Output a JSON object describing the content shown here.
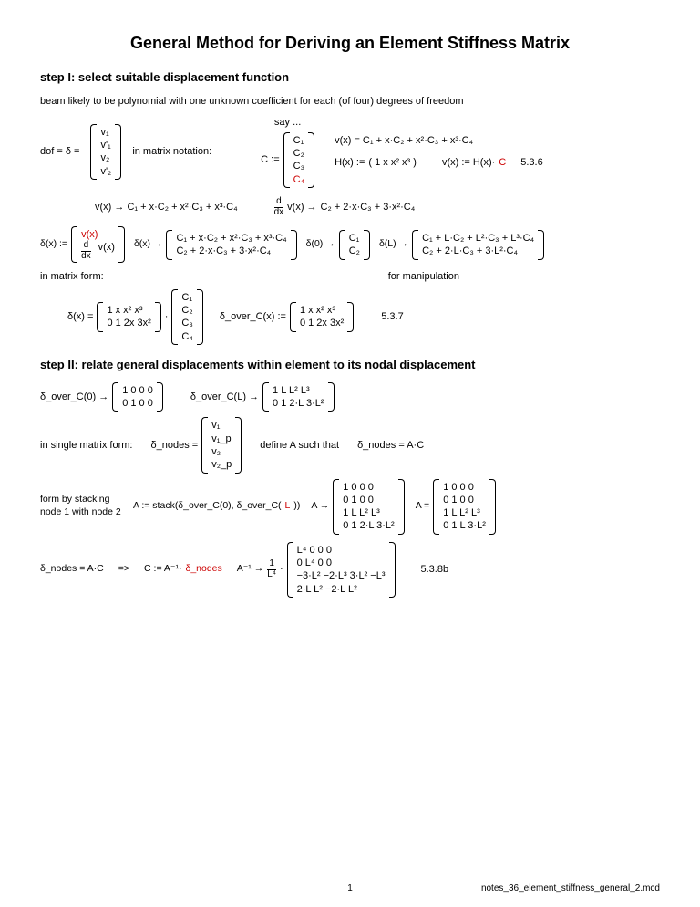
{
  "title": "General Method for Deriving an Element Stiffness Matrix",
  "step1_heading": "step I:  select suitable displacement function",
  "step1_intro": "beam likely to be polynomial with one unknown coefficient for each (of four) degrees of freedom",
  "say": "say ...",
  "dof_label": "dof = δ =",
  "dof_vec": [
    "v₁",
    "v'₁",
    "v₂",
    "v'₂"
  ],
  "in_matrix_notation": "in matrix notation:",
  "C_label": "C :=",
  "C_vec": [
    "C₁",
    "C₂",
    "C₃",
    "C₄"
  ],
  "H_label": "H(x) :=",
  "H_row": "( 1  x  x²  x³ )",
  "vx_poly": "v(x) = C₁ + x·C₂ + x²·C₃ + x³·C₄",
  "vx_HC": "v(x) := H(x)·",
  "vx_HC_red": "C",
  "ref_536": "5.3.6",
  "line_v_arrow": "v(x) → C₁ + x·C₂ + x²·C₃ + x³·C₄",
  "line_dv_arrow_lhs": "d/dx v(x) →",
  "line_dv_arrow_rhs": "C₂ + 2·x·C₃ + 3·x²·C₄",
  "delta_def_lhs": "δ(x) :=",
  "delta_def_top_red": "v(x)",
  "delta_def_bot": "d/dx v(x)",
  "delta_x_arrow": "δ(x) →",
  "delta_x_r1": "C₁ + x·C₂ + x²·C₃ + x³·C₄",
  "delta_x_r2": "C₂ + 2·x·C₃ + 3·x²·C₄",
  "delta0_arrow": "δ(0) →",
  "delta0_r1": "C₁",
  "delta0_r2": "C₂",
  "deltaL_arrow": "δ(L) →",
  "deltaL_r1": "C₁ + L·C₂ + L²·C₃ + L³·C₄",
  "deltaL_r2": "C₂ + 2·L·C₃ + 3·L²·C₄",
  "in_matrix_form": "in matrix form:",
  "for_manipulation": "for manipulation",
  "delta_x_eq": "δ(x) =",
  "mat2x4_r1": "1  x  x²  x³",
  "mat2x4_r2": "0  1  2x  3x²",
  "delta_over_C_def": "δ_over_C(x) :=",
  "ref_537": "5.3.7",
  "step2_heading": "step II:  relate general displacements within element to its nodal displacement",
  "doC0_lhs": "δ_over_C(0) →",
  "doC0_r1": "1  0  0  0",
  "doC0_r2": "0  1  0  0",
  "doCL_lhs": "δ_over_C(L) →",
  "doCL_r1": "1  L  L²  L³",
  "doCL_r2": "0  1  2·L  3·L²",
  "single_matrix": "in single matrix form:",
  "dnodes_eq": "δ_nodes =",
  "dnodes_vec": [
    "v₁",
    "v₁_p",
    "v₂",
    "v₂_p"
  ],
  "define_A": "define A such that",
  "dnodes_AC": "δ_nodes = A·C",
  "stack_note": "form by stacking node 1 with node 2",
  "A_def": "A := stack(δ_over_C(0), δ_over_C(",
  "A_def_red": "L",
  "A_def_tail": "))",
  "A_arrow": "A →",
  "A_r1": "1  0  0     0",
  "A_r2": "0  1  0     0",
  "A_r3": "1  L  L²   L³",
  "A_r4": "0  1  2·L  3·L²",
  "A_eq": "A =",
  "A2_r1": "1  0  0     0",
  "A2_r2": "0  1  0     0",
  "A2_r3": "1  L  L²   L³",
  "A2_r4": "0  1  L   3·L²",
  "implies": "=>",
  "C_assign": "C := A⁻¹·",
  "C_assign_red": "δ_nodes",
  "Ainv_arrow_lhs": "A⁻¹ →",
  "Ainv_frac": "1 / L⁴ ·",
  "Ainv_r1": "L⁴      0       0       0",
  "Ainv_r2": "0       L⁴      0       0",
  "Ainv_r3": "−3·L²  −2·L³   3·L²   −L³",
  "Ainv_r4": "2·L     L²     −2·L    L²",
  "ref_538b": "5.3.8b",
  "page_num": "1",
  "filename": "notes_36_element_stiffness_general_2.mcd"
}
